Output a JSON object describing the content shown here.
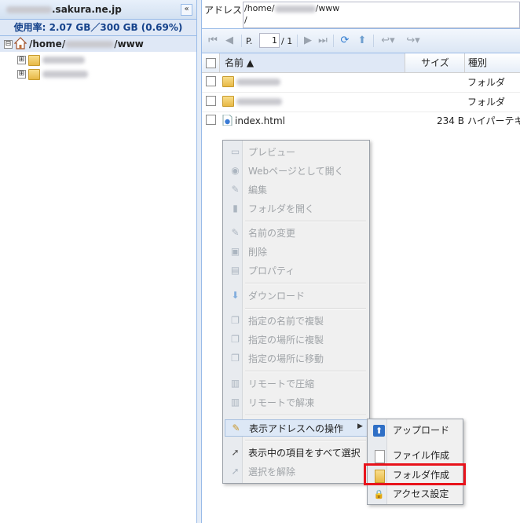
{
  "left_pane": {
    "host_suffix": ".sakura.ne.jp",
    "usage": "使用率: 2.07 GB／300 GB (0.69%)",
    "collapse_icon": "«",
    "tree": {
      "root_prefix": "/home/",
      "root_suffix": "/www",
      "root_toggle": "⊟",
      "child_toggle": "⊞"
    }
  },
  "address_bar": {
    "label": "アドレス:",
    "line1_prefix": "/home/",
    "line1_suffix": "/www",
    "line2": "/"
  },
  "toolbar": {
    "page_label": "P.",
    "page_value": "1",
    "page_total": "/ 1"
  },
  "grid": {
    "columns": {
      "name": "名前 ▲",
      "size": "サイズ",
      "type": "種別"
    },
    "rows": [
      {
        "name": "",
        "size": "",
        "type": "フォルダ",
        "kind": "folder"
      },
      {
        "name": "",
        "size": "",
        "type": "フォルダ",
        "kind": "folder"
      },
      {
        "name": "index.html",
        "size": "234 B",
        "type": "ハイパーテキ",
        "kind": "file"
      }
    ]
  },
  "context_menu": {
    "items": [
      {
        "label": "プレビュー",
        "icon": "monitor-icon",
        "enabled": false
      },
      {
        "label": "Webページとして開く",
        "icon": "web-page-icon",
        "enabled": false
      },
      {
        "label": "編集",
        "icon": "pencil-icon",
        "enabled": false
      },
      {
        "label": "フォルダを開く",
        "icon": "folder-open-icon",
        "enabled": false
      },
      {
        "label": "名前の変更",
        "icon": "pencil-icon",
        "enabled": false
      },
      {
        "label": "削除",
        "icon": "trash-icon",
        "enabled": false
      },
      {
        "label": "プロパティ",
        "icon": "properties-icon",
        "enabled": false
      },
      {
        "label": "ダウンロード",
        "icon": "download-icon",
        "enabled": false
      },
      {
        "label": "指定の名前で複製",
        "icon": "copy-icon",
        "enabled": false
      },
      {
        "label": "指定の場所に複製",
        "icon": "copy-to-icon",
        "enabled": false
      },
      {
        "label": "指定の場所に移動",
        "icon": "move-icon",
        "enabled": false
      },
      {
        "label": "リモートで圧縮",
        "icon": "zip-icon",
        "enabled": false
      },
      {
        "label": "リモートで解凍",
        "icon": "unzip-icon",
        "enabled": false
      },
      {
        "label": "表示アドレスへの操作",
        "icon": "folder-edit-icon",
        "enabled": true,
        "submenu_arrow": "▶"
      },
      {
        "label": "表示中の項目をすべて選択",
        "icon": "cursor-icon",
        "enabled": true
      },
      {
        "label": "選択を解除",
        "icon": "cursor-icon",
        "enabled": false
      }
    ]
  },
  "submenu": {
    "items": [
      {
        "label": "アップロード",
        "icon": "upload-icon"
      },
      {
        "label": "ファイル作成",
        "icon": "new-file-icon"
      },
      {
        "label": "フォルダ作成",
        "icon": "new-folder-icon"
      },
      {
        "label": "アクセス設定",
        "icon": "lock-icon"
      }
    ]
  },
  "colors": {
    "accent": "#15428b",
    "highlight": "#e8131b",
    "panel_border": "#99bbe8"
  }
}
